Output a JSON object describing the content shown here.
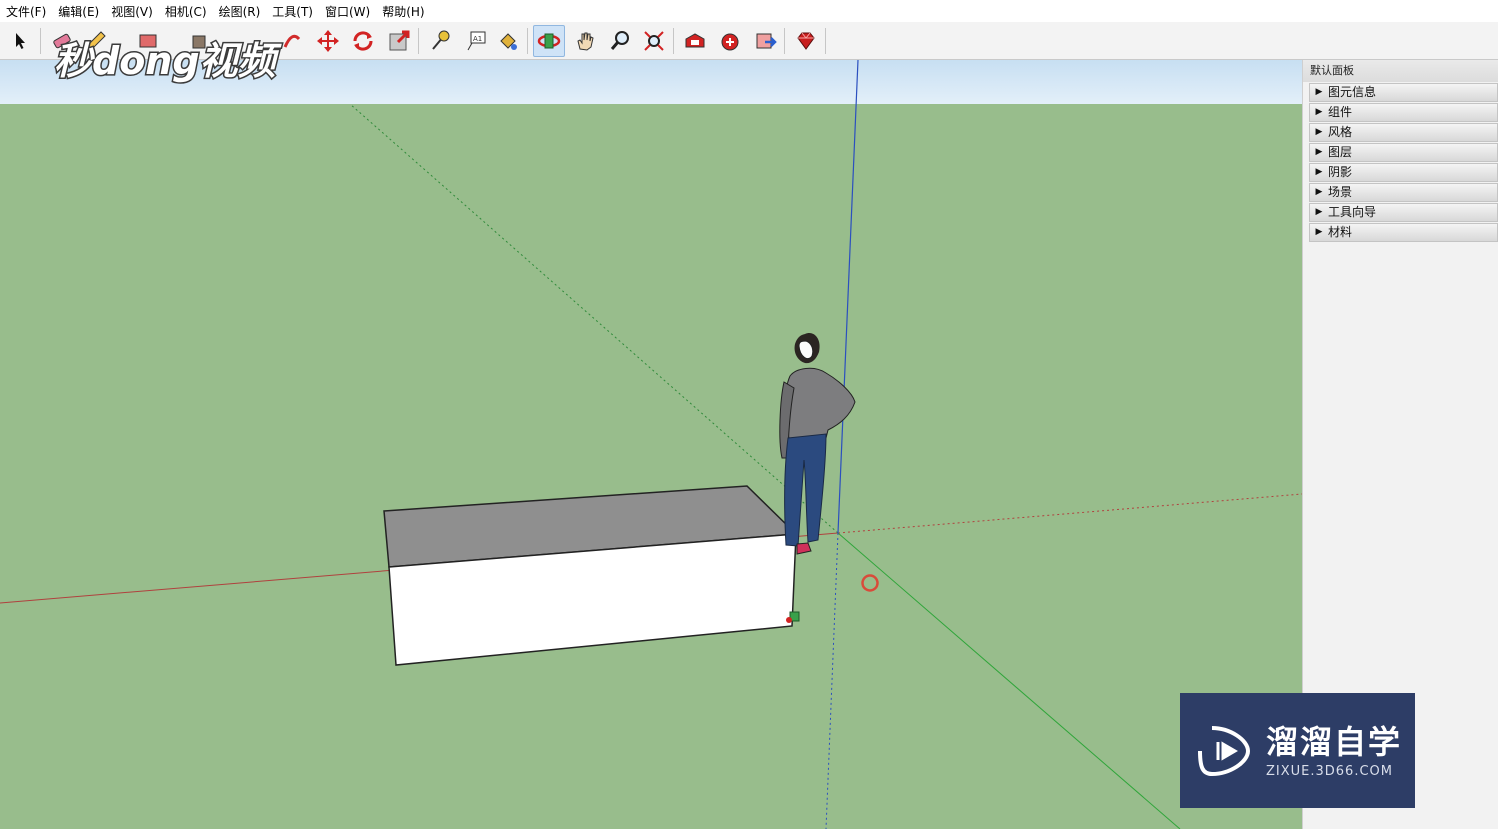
{
  "menu": [
    "文件(F)",
    "编辑(E)",
    "视图(V)",
    "相机(C)",
    "绘图(R)",
    "工具(T)",
    "窗口(W)",
    "帮助(H)"
  ],
  "watermark": {
    "logo_text": "秒dong视频"
  },
  "tray": {
    "title": "默认面板",
    "items": [
      {
        "label": "图元信息"
      },
      {
        "label": "组件"
      },
      {
        "label": "风格"
      },
      {
        "label": "图层"
      },
      {
        "label": "阴影"
      },
      {
        "label": "场景"
      },
      {
        "label": "工具向导"
      },
      {
        "label": "材料"
      }
    ]
  },
  "brand": {
    "name_cn": "溜溜自学",
    "url": "ZIXUE.3D66.COM"
  },
  "colors": {
    "sky": "#c7dff2",
    "ground": "#98bd8c",
    "axis_red": "#b0413e",
    "axis_green": "#2fa53a",
    "axis_blue": "#2b4fbf",
    "brand_bg": "#2d3d66",
    "box_top": "#8f8f8f",
    "box_front": "#ffffff"
  },
  "icons": [
    "select-arrow-icon",
    "eraser-icon",
    "pencil-icon",
    "rectangle-icon",
    "push-pull-icon",
    "follow-me-icon",
    "move-icon",
    "rotate-icon",
    "scale-icon",
    "tape-measure-icon",
    "text-icon",
    "paint-bucket-icon",
    "orbit-icon",
    "pan-icon",
    "zoom-icon",
    "zoom-extents-icon",
    "warehouse-get-models-icon",
    "warehouse-share-icon",
    "extension-warehouse-icon",
    "ruby-icon"
  ]
}
